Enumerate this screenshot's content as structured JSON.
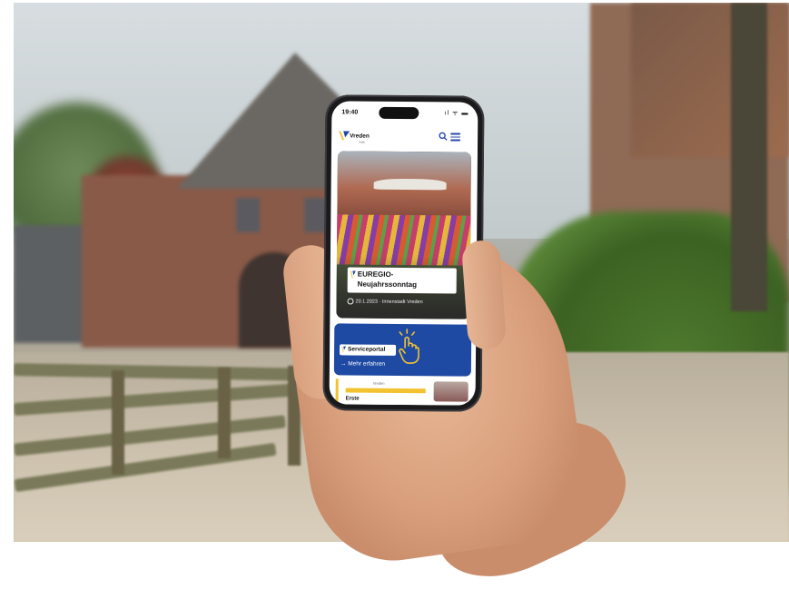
{
  "status_bar": {
    "time": "19:40",
    "icons": "ıl ᯤ ▬"
  },
  "app": {
    "brand": "Vreden",
    "brand_sub": "Stadt"
  },
  "news_card": {
    "title_line1": "EUREGIO-",
    "title_line2": "Neujahrssonntag",
    "meta": "20.1.2023 · Innenstadt Vreden"
  },
  "service_card": {
    "label": "Serviceportal",
    "link": "→ Mehr erfahren"
  },
  "bottom_card": {
    "small_text": "Vreden",
    "title": "Erste"
  },
  "colors": {
    "brand_blue": "#1f4aa3",
    "accent_yellow": "#f2c230",
    "icon_blue": "#2b4aa8"
  }
}
